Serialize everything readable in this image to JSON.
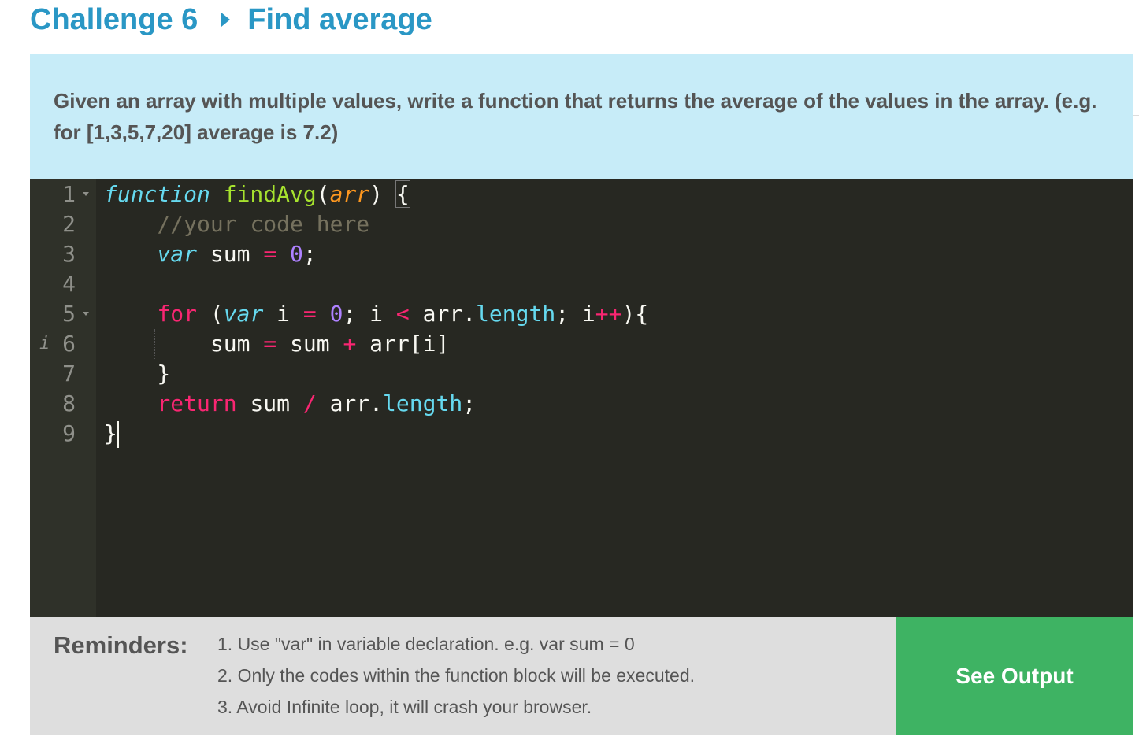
{
  "header": {
    "challenge": "Challenge 6",
    "title": "Find average",
    "accent_color": "#2a97c5",
    "separator_icon": "caret-right-icon"
  },
  "prompt": {
    "text": "Given an array with multiple values, write a function that returns the average of the values in the array. (e.g. for [1,3,5,7,20] average is 7.2)"
  },
  "editor": {
    "line_numbers": [
      "1",
      "2",
      "3",
      "4",
      "5",
      "6",
      "7",
      "8",
      "9"
    ],
    "fold_lines": [
      "1",
      "5"
    ],
    "info_line": "6",
    "info_icon": "info-annotation-icon",
    "lines": [
      [
        [
          "kw-storage",
          "function"
        ],
        [
          "plain",
          " "
        ],
        [
          "fn-name",
          "findAvg"
        ],
        [
          "plain",
          "("
        ],
        [
          "param",
          "arr"
        ],
        [
          "plain",
          ") "
        ],
        [
          "bracket-box",
          "{"
        ]
      ],
      [
        [
          "plain",
          "    "
        ],
        [
          "cmt",
          "//your code here"
        ]
      ],
      [
        [
          "plain",
          "    "
        ],
        [
          "kw-storage",
          "var"
        ],
        [
          "plain",
          " sum "
        ],
        [
          "op",
          "="
        ],
        [
          "plain",
          " "
        ],
        [
          "num-lit",
          "0"
        ],
        [
          "plain",
          ";"
        ]
      ],
      [],
      [
        [
          "plain",
          "    "
        ],
        [
          "kw-ctrl",
          "for"
        ],
        [
          "plain",
          " ("
        ],
        [
          "kw-storage",
          "var"
        ],
        [
          "plain",
          " i "
        ],
        [
          "op",
          "="
        ],
        [
          "plain",
          " "
        ],
        [
          "num-lit",
          "0"
        ],
        [
          "plain",
          "; i "
        ],
        [
          "op",
          "<"
        ],
        [
          "plain",
          " arr."
        ],
        [
          "prop",
          "length"
        ],
        [
          "plain",
          "; i"
        ],
        [
          "op",
          "++"
        ],
        [
          "plain",
          "){"
        ]
      ],
      [
        [
          "plain",
          "        sum "
        ],
        [
          "op",
          "="
        ],
        [
          "plain",
          " sum "
        ],
        [
          "op",
          "+"
        ],
        [
          "plain",
          " arr[i]"
        ]
      ],
      [
        [
          "plain",
          "    }"
        ]
      ],
      [
        [
          "plain",
          "    "
        ],
        [
          "kw-ctrl",
          "return"
        ],
        [
          "plain",
          " sum "
        ],
        [
          "op",
          "/"
        ],
        [
          "plain",
          " arr."
        ],
        [
          "prop",
          "length"
        ],
        [
          "plain",
          ";"
        ]
      ],
      [
        [
          "plain",
          "}"
        ],
        [
          "cursor",
          ""
        ]
      ]
    ]
  },
  "reminders": {
    "label": "Reminders:",
    "items": [
      "1. Use \"var\" in variable declaration. e.g. var sum = 0",
      "2. Only the codes within the function block will be executed.",
      "3. Avoid Infinite loop, it will crash your browser."
    ]
  },
  "actions": {
    "see_output_label": "See Output",
    "button_color": "#3eb363"
  }
}
